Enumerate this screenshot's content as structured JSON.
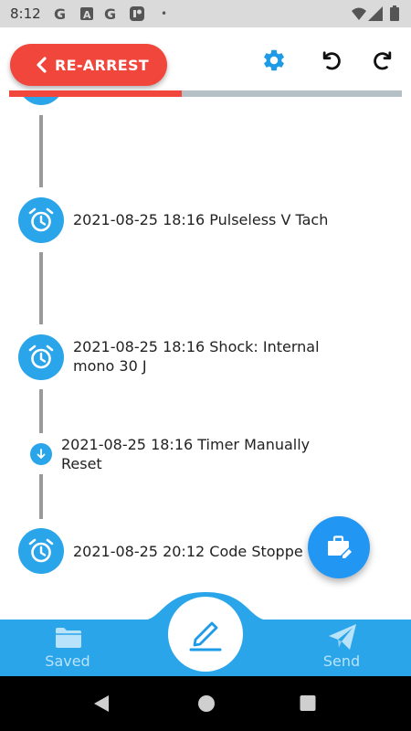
{
  "status_bar": {
    "time": "8:12",
    "notification_icons": [
      "google-g-icon",
      "news-a-icon",
      "google-g-icon",
      "photo-app-icon"
    ],
    "dot": "•"
  },
  "header": {
    "rearrest_label": "RE-ARREST",
    "progress_fraction": 0.44,
    "icons": [
      "gear-icon",
      "undo-icon",
      "redo-icon"
    ]
  },
  "timeline": {
    "events": [
      {
        "text_line1": "2021-08-25 18:16 Pulseless V Tach",
        "text_line2": "",
        "icon": "alarm-clock-icon"
      },
      {
        "text_line1": "2021-08-25 18:16 Shock: Internal",
        "text_line2": "mono 30 J",
        "icon": "alarm-clock-icon"
      },
      {
        "text_line1": "2021-08-25 18:16 Timer Manually",
        "text_line2": "Reset",
        "icon": "arrow-down-icon"
      },
      {
        "text_line1": "2021-08-25 20:12 Code Stoppe",
        "text_line2": "",
        "icon": "alarm-clock-icon"
      }
    ]
  },
  "fab": {
    "icon": "briefcase-edit-icon"
  },
  "bottom_nav": {
    "saved_label": "Saved",
    "send_label": "Send",
    "center_icon": "pencil-icon"
  },
  "colors": {
    "accent": "#2aa5ea",
    "danger": "#f0463c",
    "fab": "#2196f3"
  }
}
